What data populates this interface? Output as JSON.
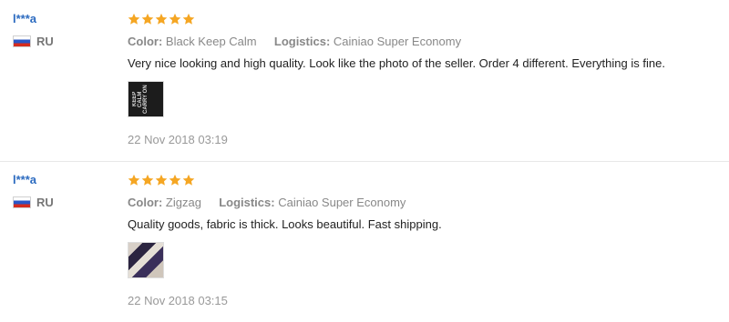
{
  "reviews": [
    {
      "user": "l***a",
      "country": "RU",
      "rating": 5,
      "color_label": "Color:",
      "color_value": "Black Keep Calm",
      "logistics_label": "Logistics:",
      "logistics_value": "Cainiao Super Economy",
      "text": "Very nice looking and high quality. Look like the photo of the seller. Order 4 different. Everything is fine.",
      "photo": {
        "icon": "keep-calm-photo"
      },
      "date": "22 Nov 2018 03:19"
    },
    {
      "user": "l***a",
      "country": "RU",
      "rating": 5,
      "color_label": "Color:",
      "color_value": "Zigzag",
      "logistics_label": "Logistics:",
      "logistics_value": "Cainiao Super Economy",
      "text": "Quality goods, fabric is thick. Looks beautiful. Fast shipping.",
      "photo": {
        "icon": "zigzag-photo"
      },
      "date": "22 Nov 2018 03:15"
    }
  ],
  "colors": {
    "star": "#f5a623",
    "username": "#2c6bc0"
  }
}
